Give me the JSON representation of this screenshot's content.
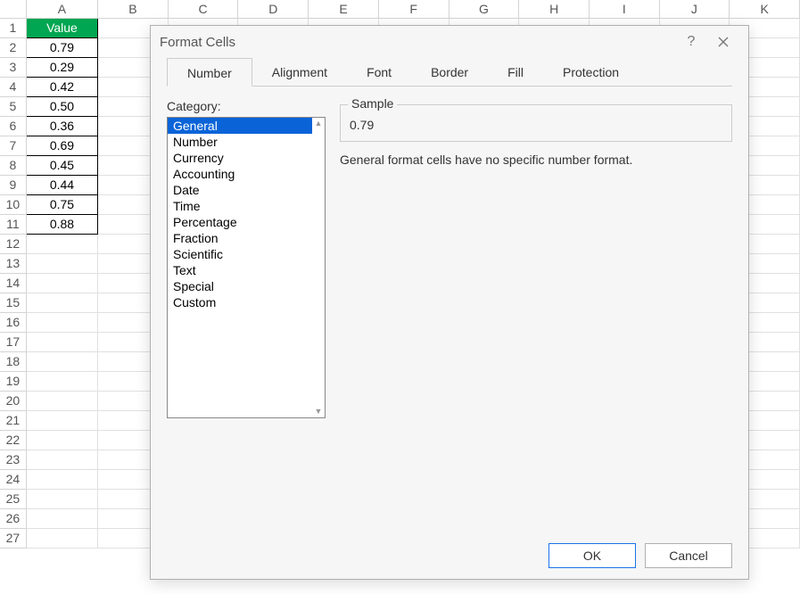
{
  "spreadsheet": {
    "columns": [
      "A",
      "B",
      "C",
      "D",
      "E",
      "F",
      "G",
      "H",
      "I",
      "J",
      "K"
    ],
    "rowCount": 27,
    "header": {
      "label": "Value"
    },
    "values": [
      "0.79",
      "0.29",
      "0.42",
      "0.50",
      "0.36",
      "0.69",
      "0.45",
      "0.44",
      "0.75",
      "0.88"
    ]
  },
  "dialog": {
    "title": "Format Cells",
    "help_label": "?",
    "tabs": [
      "Number",
      "Alignment",
      "Font",
      "Border",
      "Fill",
      "Protection"
    ],
    "activeTab": 0,
    "categoryLabel": "Category:",
    "categories": [
      "General",
      "Number",
      "Currency",
      "Accounting",
      "Date",
      "Time",
      "Percentage",
      "Fraction",
      "Scientific",
      "Text",
      "Special",
      "Custom"
    ],
    "selectedCategory": 0,
    "sample": {
      "legend": "Sample",
      "value": "0.79"
    },
    "description": "General format cells have no specific number format.",
    "buttons": {
      "ok": "OK",
      "cancel": "Cancel"
    }
  }
}
